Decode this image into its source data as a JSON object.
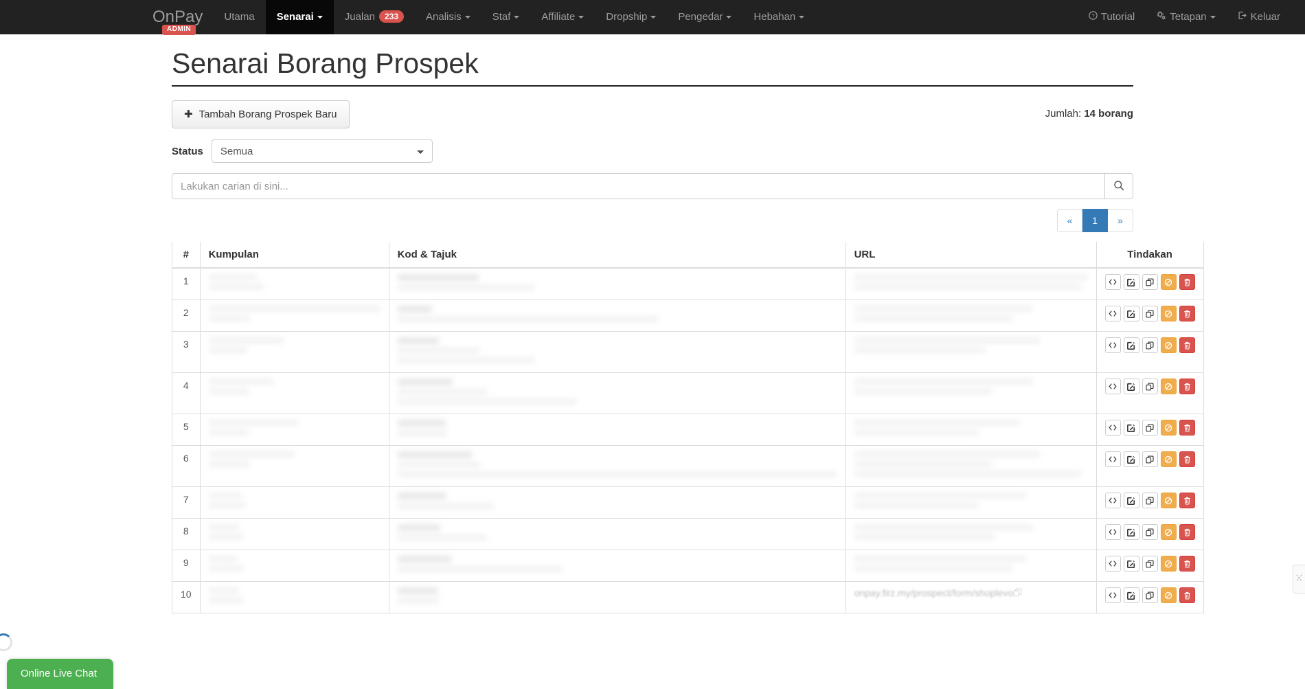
{
  "navbar": {
    "brand": "OnPay",
    "brand_badge": "ADMIN",
    "items": [
      {
        "label": "Utama",
        "caret": false,
        "active": false,
        "badge": null
      },
      {
        "label": "Senarai",
        "caret": true,
        "active": true,
        "badge": null
      },
      {
        "label": "Jualan",
        "caret": false,
        "active": false,
        "badge": "233"
      },
      {
        "label": "Analisis",
        "caret": true,
        "active": false,
        "badge": null
      },
      {
        "label": "Staf",
        "caret": true,
        "active": false,
        "badge": null
      },
      {
        "label": "Affiliate",
        "caret": true,
        "active": false,
        "badge": null
      },
      {
        "label": "Dropship",
        "caret": true,
        "active": false,
        "badge": null
      },
      {
        "label": "Pengedar",
        "caret": true,
        "active": false,
        "badge": null
      },
      {
        "label": "Hebahan",
        "caret": true,
        "active": false,
        "badge": null
      }
    ],
    "right_items": [
      {
        "label": "Tutorial",
        "icon": "question-circle-icon",
        "caret": false
      },
      {
        "label": "Tetapan",
        "icon": "gears-icon",
        "caret": true
      },
      {
        "label": "Keluar",
        "icon": "sign-out-icon",
        "caret": false
      }
    ]
  },
  "page": {
    "title": "Senarai Borang Prospek",
    "add_button": "Tambah Borang Prospek Baru",
    "count_prefix": "Jumlah:",
    "count_value": "14 borang"
  },
  "filter": {
    "status_label": "Status",
    "status_selected": "Semua",
    "status_options": [
      "Semua"
    ]
  },
  "search": {
    "placeholder": "Lakukan carian di sini...",
    "value": "",
    "button_icon": "search-icon"
  },
  "pagination": {
    "prev": "«",
    "next": "»",
    "pages": [
      "1"
    ],
    "current": "1"
  },
  "table": {
    "columns": [
      "#",
      "Kumpulan",
      "Kod & Tajuk",
      "URL",
      "Tindakan"
    ],
    "rows": [
      {
        "num": "1",
        "kumpulan": "",
        "kod_tajuk": "",
        "url": ""
      },
      {
        "num": "2",
        "kumpulan": "",
        "kod_tajuk": "",
        "url": ""
      },
      {
        "num": "3",
        "kumpulan": "",
        "kod_tajuk": "",
        "url": ""
      },
      {
        "num": "4",
        "kumpulan": "",
        "kod_tajuk": "",
        "url": ""
      },
      {
        "num": "5",
        "kumpulan": "",
        "kod_tajuk": "",
        "url": ""
      },
      {
        "num": "6",
        "kumpulan": "",
        "kod_tajuk": "",
        "url": ""
      },
      {
        "num": "7",
        "kumpulan": "",
        "kod_tajuk": "",
        "url": ""
      },
      {
        "num": "8",
        "kumpulan": "",
        "kod_tajuk": "",
        "url": ""
      },
      {
        "num": "9",
        "kumpulan": "",
        "kod_tajuk": "",
        "url": ""
      },
      {
        "num": "10",
        "kumpulan": "",
        "kod_tajuk": "",
        "url": "onpay.firz.my/prospect/form/shoplevo"
      }
    ],
    "action_icons": [
      "code-icon",
      "edit-icon",
      "copy-icon",
      "disable-icon",
      "delete-icon"
    ]
  },
  "widgets": {
    "live_chat": "Online Live Chat",
    "spinner": "loading-spinner",
    "side_tab": "side-handle-icon"
  },
  "colors": {
    "navbar_bg": "#222222",
    "navbar_active_bg": "#080808",
    "badge_red": "#d9534f",
    "pager_active": "#337ab7",
    "warn_orange": "#f0ad4e",
    "danger_red": "#d9534f",
    "chat_green": "#4caf50"
  }
}
